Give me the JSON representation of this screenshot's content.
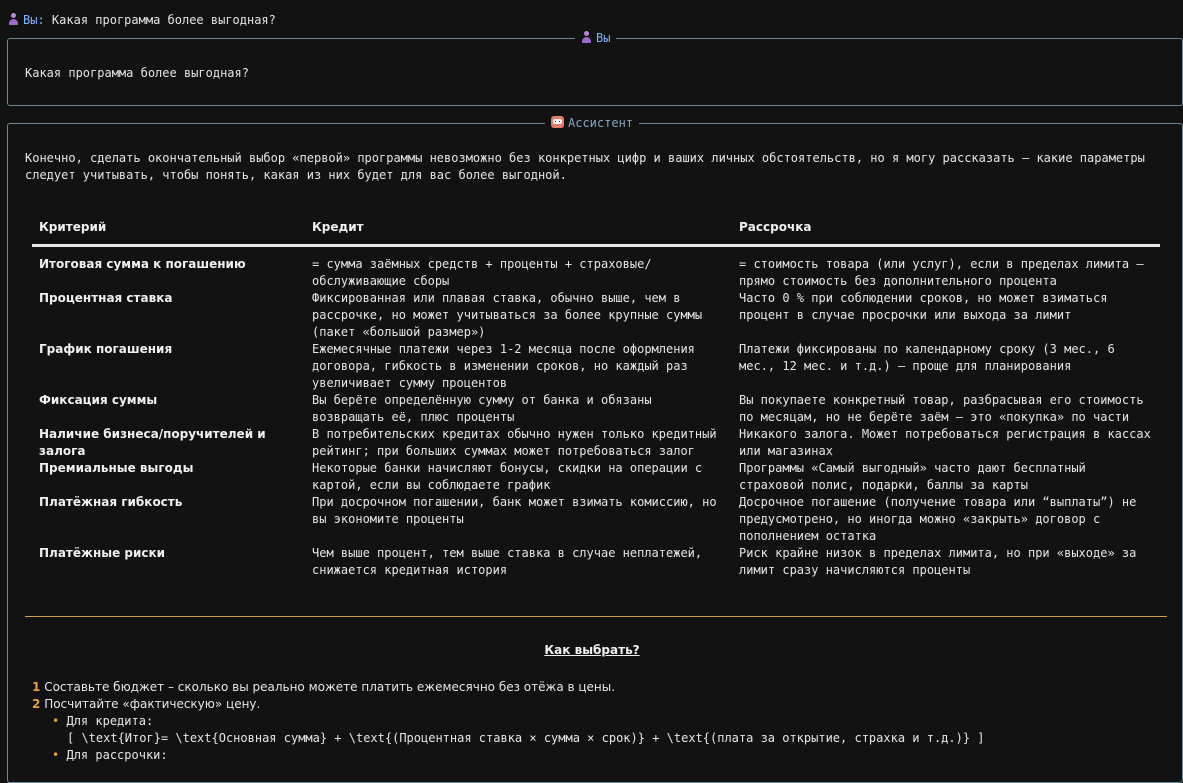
{
  "prompt_line": {
    "who": "Вы",
    "text": "Какая программа более выгодная?"
  },
  "user_box": {
    "label": "Вы",
    "message": "Какая программа более выгодная?"
  },
  "assistant_box": {
    "label": "Ассистент",
    "intro": "Конечно, сделать окончательный выбор «первой» программы невозможно без конкретных цифр и ваших личных обстоятельств, но я могу рассказать — какие параметры следует учитывать, чтобы понять, какая из них будет для вас более выгодной.",
    "table": {
      "headers": [
        "Критерий",
        "Кредит",
        "Рассрочка"
      ],
      "rows": [
        [
          "Итоговая сумма к погашению",
          "= сумма заёмных средств + проценты + страховые/обслуживающие сборы",
          "= стоимость товара (или услуг), если в пределах лимита – прямо стоимость без дополнительного процента"
        ],
        [
          "Процентная ставка",
          "Фиксированная или плавая ставка, обычно выше, чем в рассрочке, но может учитываться за более крупные суммы (пакет «большой размер»)",
          "Часто 0 % при соблюдении сроков, но может взиматься процент в случае просрочки или выхода за лимит"
        ],
        [
          "График погашения",
          "Ежемесячные платежи через 1-2 месяца после оформления договора, гибкость в изменении сроков, но каждый раз увеличивает сумму процентов",
          "Платежи фиксированы по календарному сроку (3 мес., 6 мес., 12 мес. и т.д.) – проще для планирования"
        ],
        [
          "Фиксация суммы",
          "Вы берёте определённую сумму от банка и обязаны возвращать её, плюс проценты",
          "Вы покупаете конкретный товар, разбрасывая его стоимость по месяцам, но не берёте заём — это «покупка» по части"
        ],
        [
          "Наличие бизнеса/поручителей и залога",
          "В потребительских кредитах обычно нужен только кредитный рейтинг; при больших суммах может потребоваться залог",
          "Никакого залога. Может потребоваться регистрация в кассах или магазинах"
        ],
        [
          "Премиальные выгоды",
          "Некоторые банки начисляют бонусы, скидки на операции с картой, если вы соблюдаете график",
          "Программы «Самый выгодный» часто дают бесплатный страховой полис, подарки, баллы за карты"
        ],
        [
          "Платёжная гибкость",
          "При досрочном погашении, банк может взимать комиссию, но вы экономите проценты",
          "Досрочное погашение (получение товара или “выплаты”) не предусмотрено, но иногда можно «закрыть» договор с пополнением остатка"
        ],
        [
          "Платёжные риски",
          "Чем выше процент, тем выше ставка в случае неплатежей, снижается кредитная история",
          "Риск крайне низок в пределах лимита, но при «выходе» за лимит сразу начисляются проценты"
        ]
      ]
    },
    "howto_title": "Как выбрать?",
    "steps": [
      {
        "num": "1",
        "text": "Составьте бюджет – сколько вы реально можете платить ежемесячно без отёжа в цены."
      },
      {
        "num": "2",
        "text": "Посчитайте «фактическую» цену."
      }
    ],
    "sub_bullets": [
      {
        "label": "Для кредита:",
        "formula": "[ \\text{Итог}= \\text{Основная сумма} + \\text{(Процентная ставка × сумма × срок)} + \\text{(плата за открытие, страхка и т.д.)} ]"
      },
      {
        "label": "Для рассрочки:",
        "formula": ""
      }
    ]
  }
}
